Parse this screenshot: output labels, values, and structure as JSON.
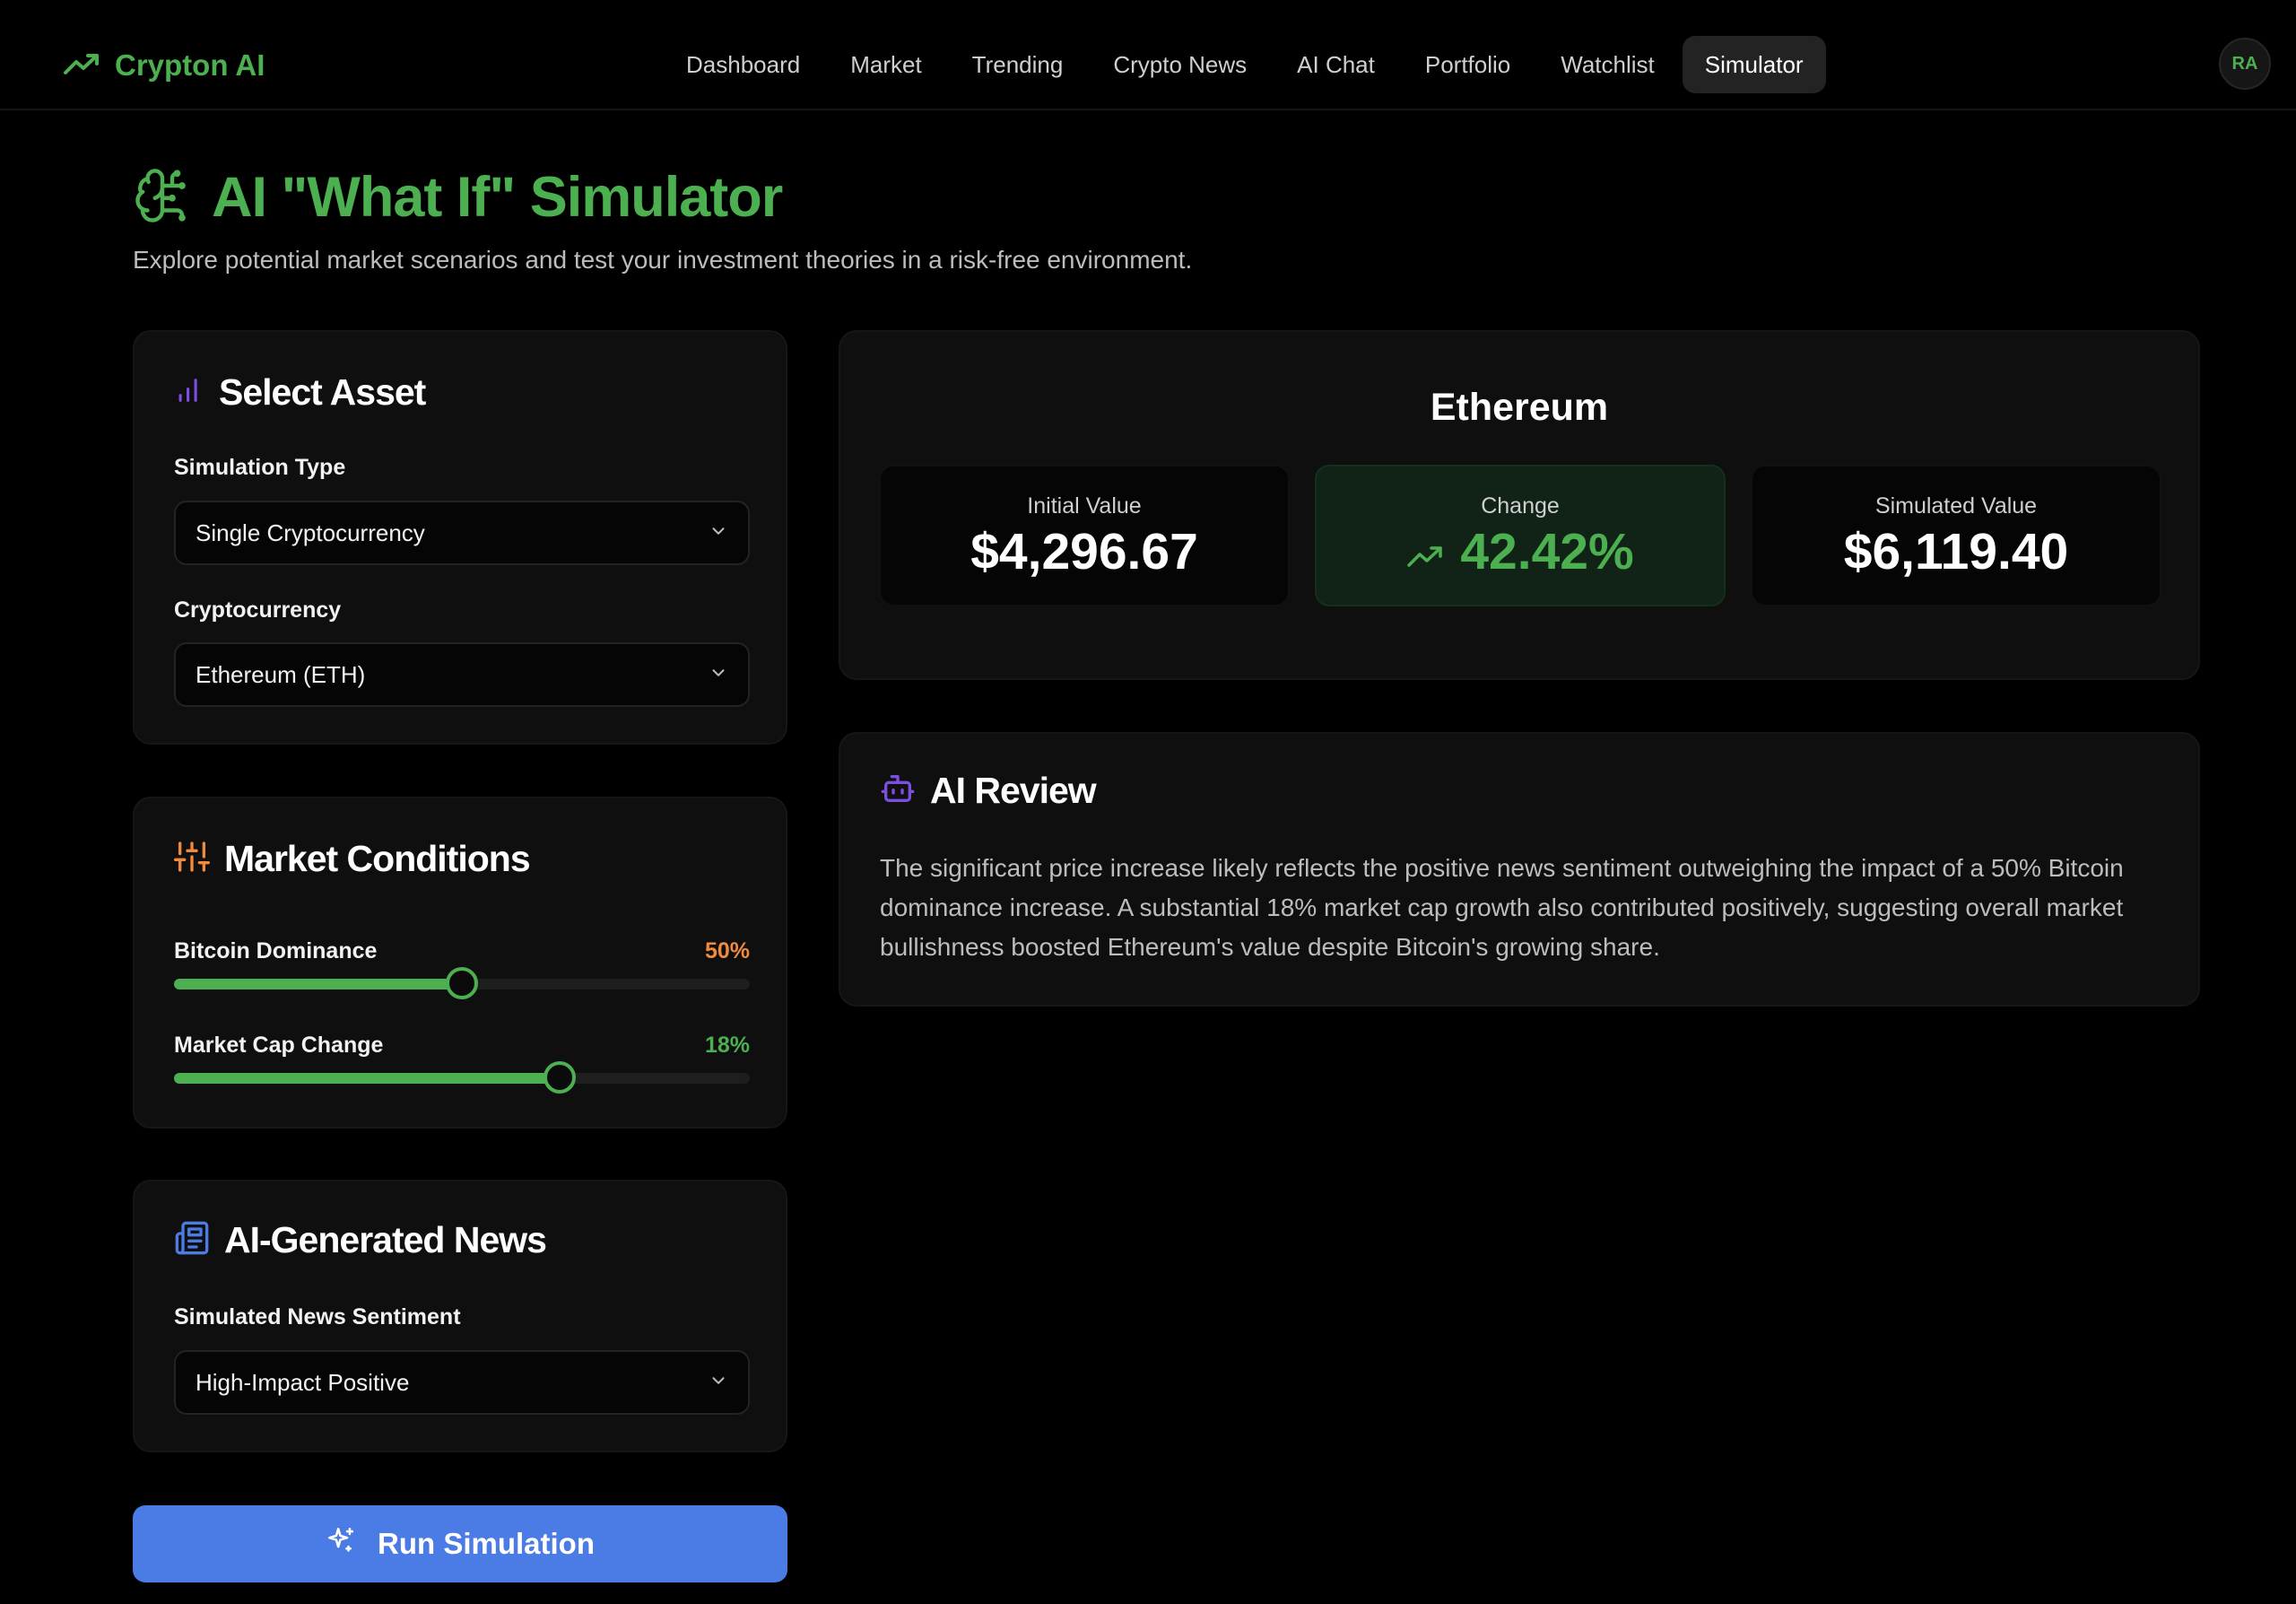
{
  "app": {
    "brand": "Crypton AI",
    "avatar_initials": "RA"
  },
  "nav": {
    "items": [
      {
        "label": "Dashboard"
      },
      {
        "label": "Market"
      },
      {
        "label": "Trending"
      },
      {
        "label": "Crypto News"
      },
      {
        "label": "AI Chat"
      },
      {
        "label": "Portfolio"
      },
      {
        "label": "Watchlist"
      },
      {
        "label": "Simulator",
        "active": true
      }
    ]
  },
  "page": {
    "title": "AI \"What If\" Simulator",
    "subtitle": "Explore potential market scenarios and test your investment theories in a risk-free environment."
  },
  "select_asset": {
    "title": "Select Asset",
    "simulation_type_label": "Simulation Type",
    "simulation_type_value": "Single Cryptocurrency",
    "cryptocurrency_label": "Cryptocurrency",
    "cryptocurrency_value": "Ethereum (ETH)"
  },
  "market_conditions": {
    "title": "Market Conditions",
    "bitcoin_dominance": {
      "label": "Bitcoin Dominance",
      "display": "50%",
      "level": 0.5
    },
    "market_cap_change": {
      "label": "Market Cap Change",
      "display": "18%",
      "level": 0.67
    }
  },
  "news": {
    "title": "AI-Generated News",
    "sentiment_label": "Simulated News Sentiment",
    "sentiment_value": "High-Impact Positive"
  },
  "run_button": {
    "label": "Run Simulation"
  },
  "result": {
    "asset_name": "Ethereum",
    "initial_label": "Initial Value",
    "initial_value": "$4,296.67",
    "change_label": "Change",
    "change_value": "42.42%",
    "simulated_label": "Simulated Value",
    "simulated_value": "$6,119.40"
  },
  "review": {
    "title": "AI Review",
    "text": "The significant price increase likely reflects the positive news sentiment outweighing the impact of a 50% Bitcoin dominance increase. A substantial 18% market cap growth also contributed positively, suggesting overall market bullishness boosted Ethereum's value despite Bitcoin's growing share."
  },
  "colors": {
    "accent_green": "#4caf50",
    "accent_orange": "#f08a3c",
    "accent_purple": "#7b4fe0",
    "accent_blue": "#4b7be5"
  },
  "icons": {
    "brand": "trending-up-icon",
    "title": "brain-icon",
    "select_asset": "bar-chart-icon",
    "market_conditions": "sliders-icon",
    "news": "newspaper-icon",
    "run": "sparkles-icon",
    "review": "bot-icon",
    "change": "trending-up-icon",
    "select": "chevron-down-icon"
  }
}
